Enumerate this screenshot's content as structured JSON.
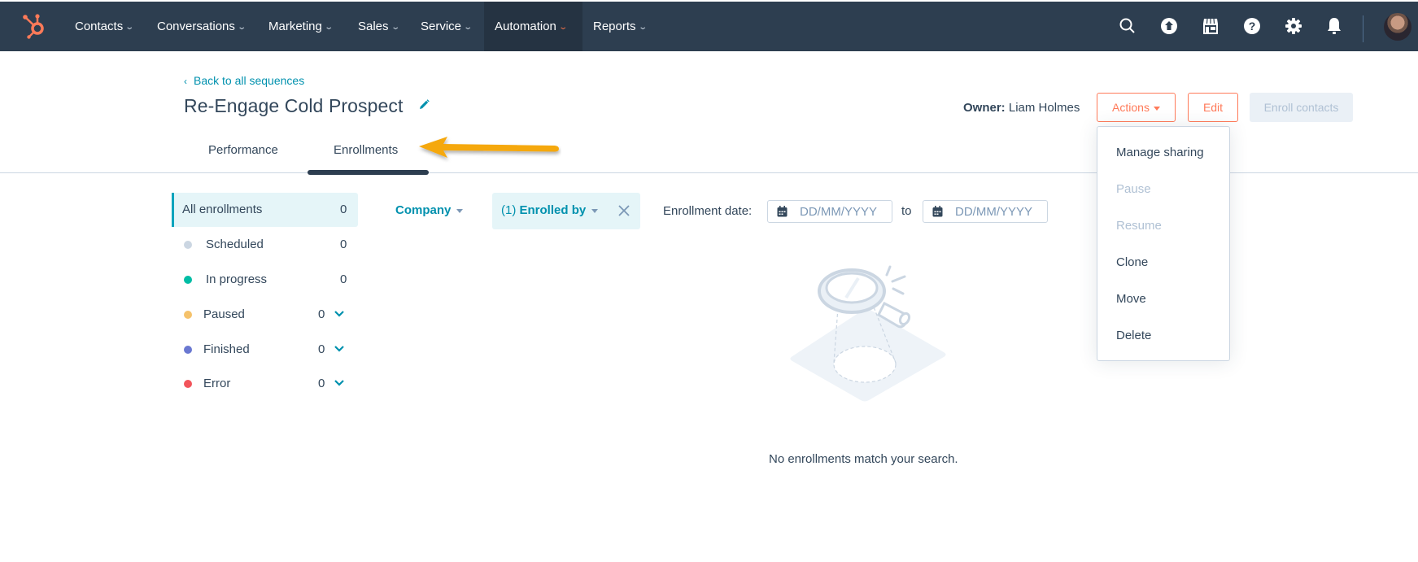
{
  "topnav": {
    "logo": "hubspot-sprocket-logo",
    "items": [
      {
        "label": "Contacts",
        "active": false
      },
      {
        "label": "Conversations",
        "active": false
      },
      {
        "label": "Marketing",
        "active": false
      },
      {
        "label": "Sales",
        "active": false
      },
      {
        "label": "Service",
        "active": false
      },
      {
        "label": "Automation",
        "active": true
      },
      {
        "label": "Reports",
        "active": false
      }
    ],
    "icons": [
      "search-icon",
      "upgrade-arrow-icon",
      "marketplace-icon",
      "help-icon",
      "settings-icon",
      "notifications-icon"
    ],
    "accent": "#ff7a59",
    "background": "#2d3e50"
  },
  "header": {
    "back_label": "Back to all sequences",
    "title": "Re-Engage Cold Prospect",
    "owner_label": "Owner:",
    "owner_name": "Liam Holmes",
    "actions_label": "Actions",
    "edit_label": "Edit",
    "enroll_label": "Enroll contacts"
  },
  "tabs": [
    {
      "label": "Performance",
      "active": false
    },
    {
      "label": "Enrollments",
      "active": true
    }
  ],
  "annotation": {
    "type": "arrow",
    "color": "#f5a80f",
    "points_to": "Enrollments"
  },
  "sidebar": {
    "items": [
      {
        "label": "All enrollments",
        "count": "0",
        "active": true
      },
      {
        "label": "Scheduled",
        "count": "0",
        "color": "#cbd6e2"
      },
      {
        "label": "In progress",
        "count": "0",
        "color": "#00bda5"
      },
      {
        "label": "Paused",
        "count": "0",
        "color": "#f5c26b",
        "expandable": true
      },
      {
        "label": "Finished",
        "count": "0",
        "color": "#6a78d1",
        "expandable": true
      },
      {
        "label": "Error",
        "count": "0",
        "color": "#f2545b",
        "expandable": true
      }
    ]
  },
  "filters": {
    "company_label": "Company",
    "enrolled_by_count": "(1)",
    "enrolled_by_label": "Enrolled by",
    "date_label": "Enrollment date:",
    "from_placeholder": "DD/MM/YYYY",
    "to_label": "to",
    "to_placeholder": "DD/MM/YYYY"
  },
  "empty_state": {
    "message": "No enrollments match your search."
  },
  "actions_menu": {
    "items": [
      {
        "label": "Manage sharing",
        "disabled": false
      },
      {
        "label": "Pause",
        "disabled": true
      },
      {
        "label": "Resume",
        "disabled": true
      },
      {
        "label": "Clone",
        "disabled": false
      },
      {
        "label": "Move",
        "disabled": false
      },
      {
        "label": "Delete",
        "disabled": false
      }
    ]
  }
}
